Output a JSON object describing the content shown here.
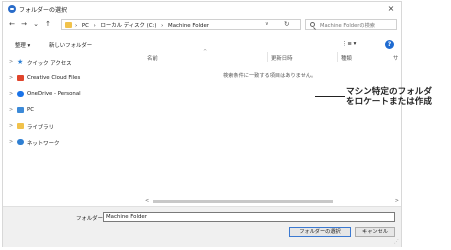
{
  "window": {
    "title": "フォルダーの選択",
    "close_glyph": "×"
  },
  "nav": {
    "back": "←",
    "forward": "→",
    "down": "⌄",
    "up": "↑",
    "breadcrumbs": [
      "›",
      "PC",
      "›",
      "ローカル ディスク (C:)",
      "›",
      "Machine Folder"
    ],
    "refresh": "↻",
    "search_placeholder": "Machine Folderの検索"
  },
  "toolbar": {
    "organize": "整理 ▾",
    "new_folder": "新しいフォルダー",
    "view": "⋮≡ ▾",
    "help": "?"
  },
  "sidebar": {
    "items": [
      {
        "chev": ">",
        "label": "クイック アクセス",
        "icon": "star-icon"
      },
      {
        "chev": ">",
        "label": "Creative Cloud Files",
        "icon": "creative-cloud-icon"
      },
      {
        "chev": ">",
        "label": "OneDrive - Personal",
        "icon": "cloud-icon"
      },
      {
        "chev": ">",
        "label": "PC",
        "icon": "pc-icon"
      },
      {
        "chev": ">",
        "label": "ライブラリ",
        "icon": "library-icon"
      },
      {
        "chev": ">",
        "label": "ネットワーク",
        "icon": "network-icon"
      }
    ]
  },
  "list": {
    "columns": [
      "名前",
      "更新日時",
      "種類",
      "サ"
    ],
    "sort_indicator": "^",
    "empty_message": "検索条件に一致する項目はありません。"
  },
  "scroll": {
    "left": "<",
    "right": ">"
  },
  "footer": {
    "folder_label": "フォルダー:",
    "folder_value": "Machine Folder",
    "select_button": "フォルダーの選択",
    "cancel_button": "キャンセル"
  },
  "annotation": {
    "line1": "マシン特定のフォルダ",
    "line2": "をロケートまたは作成"
  }
}
